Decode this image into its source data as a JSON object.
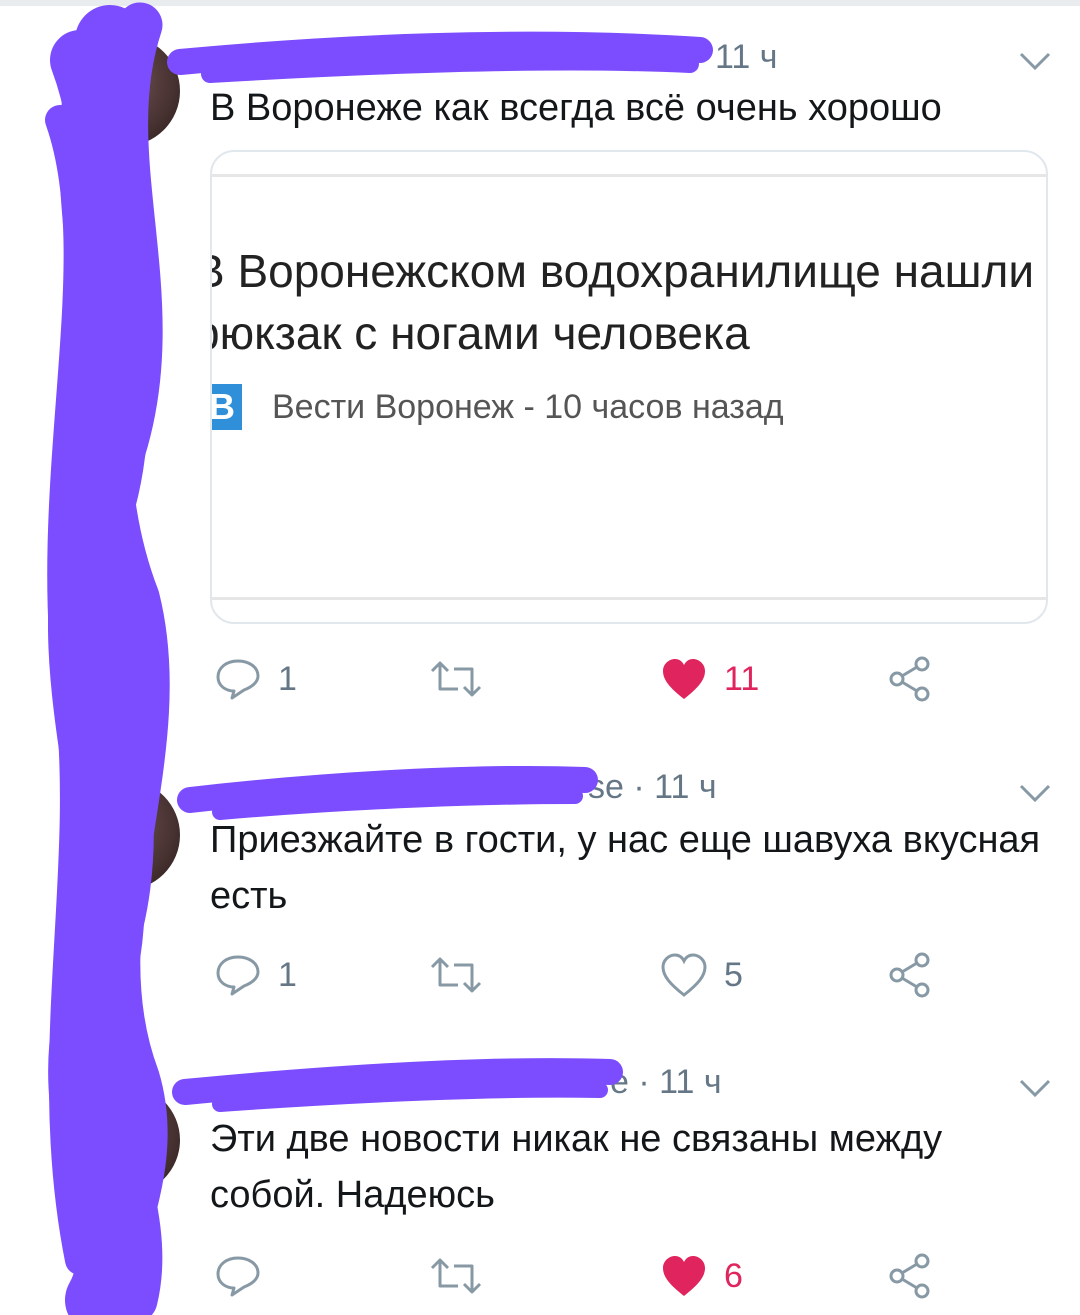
{
  "tweets": [
    {
      "time": "11 ч",
      "handle_tail": "",
      "text": "В Воронеже как всегда всё очень хорошо",
      "card": {
        "headline": "В Воронежском водохранилище нашли рюкзак с ногами человека",
        "source_icon": "В",
        "source": "Вести Воронеж - 10 часов назад"
      },
      "reply_count": "1",
      "like_count": "11",
      "liked": true
    },
    {
      "time": "11 ч",
      "handle_tail": "se",
      "text": "Приезжайте в гости, у нас еще шавуха вкусная есть",
      "reply_count": "1",
      "like_count": "5",
      "liked": false
    },
    {
      "time": "11 ч",
      "handle_tail": "e",
      "text": "Эти две новости никак не связаны между собой. Надеюсь",
      "reply_count": "",
      "like_count": "6",
      "liked": true
    }
  ],
  "icons": {
    "reply": "reply-icon",
    "retweet": "retweet-icon",
    "like": "heart-icon",
    "share": "share-icon",
    "menu": "chevron-down-icon"
  },
  "colors": {
    "like": "#e0245e",
    "muted": "#657786",
    "redaction": "#7c4dff"
  }
}
